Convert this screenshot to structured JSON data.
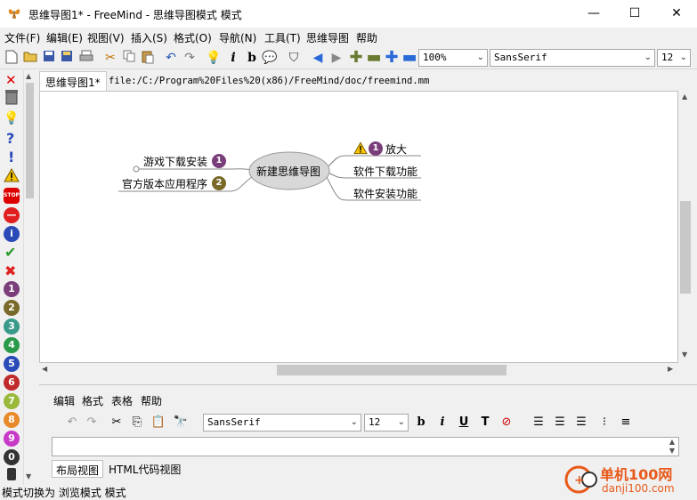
{
  "window": {
    "title": "思维导图1* - FreeMind - 思维导图模式 模式",
    "minimize": "—",
    "maximize": "☐",
    "close": "✕"
  },
  "menubar": [
    "文件(F)",
    "编辑(E)",
    "视图(V)",
    "插入(S)",
    "格式(O)",
    "导航(N)",
    "工具(T)",
    "思维导图",
    "帮助"
  ],
  "toolbar": {
    "zoom": "100%",
    "font": "SansSerif",
    "size": "12"
  },
  "tabs": {
    "active": "思维导图1*",
    "file": "file:/C:/Program%20Files%20(x86)/FreeMind/doc/freemind.mm"
  },
  "map": {
    "center": "新建思维导图",
    "left": [
      {
        "text": "游戏下载安装",
        "priority": "1"
      },
      {
        "text": "官方版本应用程序",
        "priority": "2"
      }
    ],
    "right": [
      {
        "text": "放大",
        "priority": "1"
      },
      {
        "text": "软件下载功能"
      },
      {
        "text": "软件安装功能"
      }
    ]
  },
  "left_icons": [
    "?",
    "!",
    "1",
    "2",
    "3",
    "4",
    "5",
    "6",
    "7",
    "8",
    "9",
    "0"
  ],
  "notes": {
    "menu": [
      "编辑",
      "格式",
      "表格",
      "帮助"
    ],
    "font": "SansSerif",
    "size": "12",
    "view_tabs": [
      "布局视图",
      "HTML代码视图"
    ]
  },
  "status": "模式切换为 浏览模式 模式",
  "watermark": {
    "name": "单机100网",
    "url": "danji100.com"
  },
  "colors": {
    "p1": "#7a3e7a",
    "p2": "#7a6a2a",
    "center_fill": "#d8d8d8"
  }
}
